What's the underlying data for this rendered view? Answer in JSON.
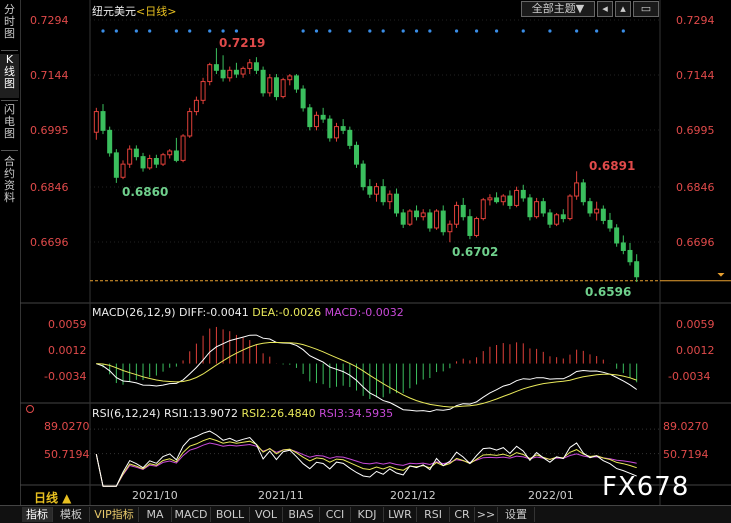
{
  "sidebar": {
    "items": [
      {
        "label": "分时图",
        "active": false
      },
      {
        "label": "K线图",
        "active": true
      },
      {
        "label": "闪电图",
        "active": false
      },
      {
        "label": "合约资料",
        "active": false
      }
    ]
  },
  "header": {
    "symbol": "纽元美元",
    "period": "<日线>",
    "theme_button": "全部主题▼",
    "icons": [
      "scroll-left-icon",
      "scroll-up-icon",
      "chart-restore-icon"
    ]
  },
  "main_chart": {
    "y_ticks": [
      "0.7294",
      "0.7144",
      "0.6995",
      "0.6846",
      "0.6696"
    ],
    "annotations": {
      "high": "0.7219",
      "low1": "0.6860",
      "high2": "0.6891",
      "low2": "0.6702",
      "last": "0.6596"
    }
  },
  "macd": {
    "label": "MACD(26,12,9)",
    "diff": "DIFF:-0.0041",
    "dea": "DEA:-0.0026",
    "macd": "MACD:-0.0032",
    "y_ticks": [
      "0.0059",
      "0.0012",
      "-0.0034"
    ]
  },
  "rsi": {
    "label": "RSI(6,12,24)",
    "rsi1": "RSI1:13.9072",
    "rsi2": "RSI2:26.4840",
    "rsi3": "RSI3:34.5935",
    "y_ticks": [
      "89.0270",
      "50.7194"
    ]
  },
  "x_axis": {
    "period_label": "日线 ▲",
    "dates": [
      "2021/10",
      "2021/11",
      "2021/12",
      "2022/01"
    ]
  },
  "bottom_tabs": [
    {
      "label": "指标",
      "active": true
    },
    {
      "label": "模板",
      "active": false
    },
    {
      "label": "VIP指标",
      "active": false,
      "vip": true
    },
    {
      "label": "MA",
      "active": false
    },
    {
      "label": "MACD",
      "active": false
    },
    {
      "label": "BOLL",
      "active": false
    },
    {
      "label": "VOL",
      "active": false
    },
    {
      "label": "BIAS",
      "active": false
    },
    {
      "label": "CCI",
      "active": false
    },
    {
      "label": "KDJ",
      "active": false
    },
    {
      "label": "LWR",
      "active": false
    },
    {
      "label": "RSI",
      "active": false
    },
    {
      "label": "CR",
      "active": false
    },
    {
      "label": ">>",
      "active": false
    },
    {
      "label": "设置",
      "active": false
    }
  ],
  "watermark": "FX678",
  "colors": {
    "up": "#e0403a",
    "down": "#3bbf5e",
    "yaxis": "#e04a4a",
    "dea": "#e8e85a",
    "macd_text": "#c84ad8",
    "dots": "#3a8ee8",
    "last_line": "#e8a030"
  },
  "chart_data": {
    "type": "candlestick",
    "candles": [
      {
        "o": 0.6995,
        "h": 0.706,
        "l": 0.6975,
        "c": 0.705
      },
      {
        "o": 0.705,
        "h": 0.707,
        "l": 0.699,
        "c": 0.7
      },
      {
        "o": 0.7,
        "h": 0.701,
        "l": 0.693,
        "c": 0.694
      },
      {
        "o": 0.694,
        "h": 0.695,
        "l": 0.686,
        "c": 0.6875
      },
      {
        "o": 0.6875,
        "h": 0.692,
        "l": 0.687,
        "c": 0.691
      },
      {
        "o": 0.691,
        "h": 0.696,
        "l": 0.69,
        "c": 0.695
      },
      {
        "o": 0.695,
        "h": 0.696,
        "l": 0.692,
        "c": 0.693
      },
      {
        "o": 0.693,
        "h": 0.694,
        "l": 0.689,
        "c": 0.69
      },
      {
        "o": 0.69,
        "h": 0.6935,
        "l": 0.6895,
        "c": 0.6925
      },
      {
        "o": 0.6925,
        "h": 0.6935,
        "l": 0.69,
        "c": 0.691
      },
      {
        "o": 0.691,
        "h": 0.694,
        "l": 0.6905,
        "c": 0.6935
      },
      {
        "o": 0.6935,
        "h": 0.695,
        "l": 0.6925,
        "c": 0.6945
      },
      {
        "o": 0.6945,
        "h": 0.698,
        "l": 0.6915,
        "c": 0.692
      },
      {
        "o": 0.692,
        "h": 0.699,
        "l": 0.6915,
        "c": 0.6985
      },
      {
        "o": 0.6985,
        "h": 0.706,
        "l": 0.698,
        "c": 0.705
      },
      {
        "o": 0.705,
        "h": 0.709,
        "l": 0.704,
        "c": 0.708
      },
      {
        "o": 0.708,
        "h": 0.714,
        "l": 0.707,
        "c": 0.713
      },
      {
        "o": 0.713,
        "h": 0.718,
        "l": 0.712,
        "c": 0.7175
      },
      {
        "o": 0.7175,
        "h": 0.7219,
        "l": 0.715,
        "c": 0.716
      },
      {
        "o": 0.716,
        "h": 0.72,
        "l": 0.713,
        "c": 0.714
      },
      {
        "o": 0.714,
        "h": 0.717,
        "l": 0.713,
        "c": 0.716
      },
      {
        "o": 0.716,
        "h": 0.718,
        "l": 0.714,
        "c": 0.715
      },
      {
        "o": 0.715,
        "h": 0.717,
        "l": 0.714,
        "c": 0.7165
      },
      {
        "o": 0.7165,
        "h": 0.719,
        "l": 0.715,
        "c": 0.718
      },
      {
        "o": 0.718,
        "h": 0.7195,
        "l": 0.715,
        "c": 0.716
      },
      {
        "o": 0.716,
        "h": 0.717,
        "l": 0.709,
        "c": 0.71
      },
      {
        "o": 0.71,
        "h": 0.715,
        "l": 0.709,
        "c": 0.714
      },
      {
        "o": 0.714,
        "h": 0.715,
        "l": 0.708,
        "c": 0.709
      },
      {
        "o": 0.709,
        "h": 0.714,
        "l": 0.7085,
        "c": 0.7135
      },
      {
        "o": 0.7135,
        "h": 0.715,
        "l": 0.712,
        "c": 0.7145
      },
      {
        "o": 0.7145,
        "h": 0.715,
        "l": 0.71,
        "c": 0.711
      },
      {
        "o": 0.711,
        "h": 0.712,
        "l": 0.705,
        "c": 0.706
      },
      {
        "o": 0.706,
        "h": 0.707,
        "l": 0.7,
        "c": 0.701
      },
      {
        "o": 0.701,
        "h": 0.705,
        "l": 0.7,
        "c": 0.704
      },
      {
        "o": 0.704,
        "h": 0.706,
        "l": 0.702,
        "c": 0.703
      },
      {
        "o": 0.703,
        "h": 0.704,
        "l": 0.697,
        "c": 0.698
      },
      {
        "o": 0.698,
        "h": 0.702,
        "l": 0.697,
        "c": 0.701
      },
      {
        "o": 0.701,
        "h": 0.703,
        "l": 0.699,
        "c": 0.7
      },
      {
        "o": 0.7,
        "h": 0.701,
        "l": 0.695,
        "c": 0.696
      },
      {
        "o": 0.696,
        "h": 0.697,
        "l": 0.69,
        "c": 0.691
      },
      {
        "o": 0.691,
        "h": 0.692,
        "l": 0.684,
        "c": 0.685
      },
      {
        "o": 0.685,
        "h": 0.687,
        "l": 0.682,
        "c": 0.683
      },
      {
        "o": 0.683,
        "h": 0.686,
        "l": 0.681,
        "c": 0.685
      },
      {
        "o": 0.685,
        "h": 0.687,
        "l": 0.68,
        "c": 0.681
      },
      {
        "o": 0.681,
        "h": 0.684,
        "l": 0.679,
        "c": 0.683
      },
      {
        "o": 0.683,
        "h": 0.6845,
        "l": 0.677,
        "c": 0.678
      },
      {
        "o": 0.678,
        "h": 0.679,
        "l": 0.674,
        "c": 0.675
      },
      {
        "o": 0.675,
        "h": 0.679,
        "l": 0.6745,
        "c": 0.6785
      },
      {
        "o": 0.6785,
        "h": 0.68,
        "l": 0.676,
        "c": 0.677
      },
      {
        "o": 0.677,
        "h": 0.679,
        "l": 0.676,
        "c": 0.678
      },
      {
        "o": 0.678,
        "h": 0.679,
        "l": 0.673,
        "c": 0.674
      },
      {
        "o": 0.674,
        "h": 0.679,
        "l": 0.6735,
        "c": 0.6785
      },
      {
        "o": 0.6785,
        "h": 0.68,
        "l": 0.672,
        "c": 0.673
      },
      {
        "o": 0.673,
        "h": 0.676,
        "l": 0.6702,
        "c": 0.675
      },
      {
        "o": 0.675,
        "h": 0.681,
        "l": 0.674,
        "c": 0.68
      },
      {
        "o": 0.68,
        "h": 0.682,
        "l": 0.676,
        "c": 0.677
      },
      {
        "o": 0.677,
        "h": 0.679,
        "l": 0.671,
        "c": 0.672
      },
      {
        "o": 0.672,
        "h": 0.677,
        "l": 0.6715,
        "c": 0.6765
      },
      {
        "o": 0.6765,
        "h": 0.682,
        "l": 0.676,
        "c": 0.6815
      },
      {
        "o": 0.6815,
        "h": 0.683,
        "l": 0.68,
        "c": 0.682
      },
      {
        "o": 0.682,
        "h": 0.6835,
        "l": 0.6805,
        "c": 0.681
      },
      {
        "o": 0.681,
        "h": 0.683,
        "l": 0.68,
        "c": 0.6825
      },
      {
        "o": 0.6825,
        "h": 0.684,
        "l": 0.679,
        "c": 0.68
      },
      {
        "o": 0.68,
        "h": 0.685,
        "l": 0.6795,
        "c": 0.684
      },
      {
        "o": 0.684,
        "h": 0.6855,
        "l": 0.681,
        "c": 0.682
      },
      {
        "o": 0.682,
        "h": 0.683,
        "l": 0.676,
        "c": 0.677
      },
      {
        "o": 0.677,
        "h": 0.682,
        "l": 0.6765,
        "c": 0.681
      },
      {
        "o": 0.681,
        "h": 0.682,
        "l": 0.677,
        "c": 0.678
      },
      {
        "o": 0.678,
        "h": 0.679,
        "l": 0.674,
        "c": 0.675
      },
      {
        "o": 0.675,
        "h": 0.678,
        "l": 0.6745,
        "c": 0.6775
      },
      {
        "o": 0.6775,
        "h": 0.679,
        "l": 0.6755,
        "c": 0.6765
      },
      {
        "o": 0.6765,
        "h": 0.683,
        "l": 0.676,
        "c": 0.6825
      },
      {
        "o": 0.6825,
        "h": 0.6891,
        "l": 0.6815,
        "c": 0.686
      },
      {
        "o": 0.686,
        "h": 0.687,
        "l": 0.68,
        "c": 0.681
      },
      {
        "o": 0.681,
        "h": 0.682,
        "l": 0.677,
        "c": 0.678
      },
      {
        "o": 0.678,
        "h": 0.681,
        "l": 0.676,
        "c": 0.679
      },
      {
        "o": 0.679,
        "h": 0.68,
        "l": 0.675,
        "c": 0.676
      },
      {
        "o": 0.676,
        "h": 0.678,
        "l": 0.673,
        "c": 0.674
      },
      {
        "o": 0.674,
        "h": 0.675,
        "l": 0.669,
        "c": 0.67
      },
      {
        "o": 0.67,
        "h": 0.672,
        "l": 0.667,
        "c": 0.668
      },
      {
        "o": 0.668,
        "h": 0.67,
        "l": 0.664,
        "c": 0.665
      },
      {
        "o": 0.665,
        "h": 0.667,
        "l": 0.6596,
        "c": 0.661
      }
    ],
    "ylim": [
      0.6596,
      0.7294
    ],
    "macd_range": [
      -0.006,
      0.0075
    ],
    "rsi_range": [
      5,
      100
    ]
  }
}
